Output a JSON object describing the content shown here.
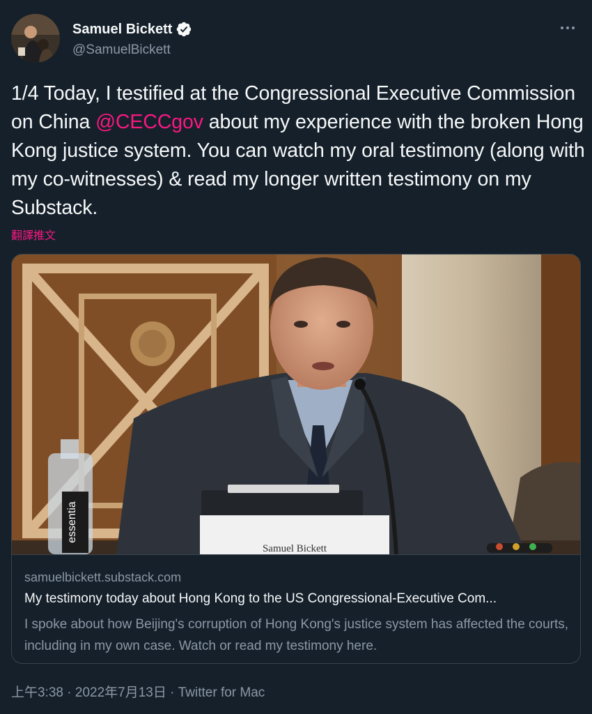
{
  "author": {
    "display_name": "Samuel Bickett",
    "handle": "@SamuelBickett",
    "verified_icon": "verified-badge-icon"
  },
  "tweet": {
    "part1": "1/4 Today, I testified at the Congressional Executive Commission on China ",
    "mention": "@CECCgov",
    "part2": " about my experience with the broken Hong Kong justice system. You can watch my oral testimony (along with my co-witnesses) & read my longer written testimony on my Substack.",
    "translate_label": "翻譯推文"
  },
  "card": {
    "domain": "samuelbickett.substack.com",
    "title": "My testimony today about Hong Kong to the US Congressional-Executive Com...",
    "description": "I spoke about how Beijing's corruption of Hong Kong's justice system has affected the courts, including in my own case. Watch or read my testimony here.",
    "image_placard": "Samuel Bickett",
    "image_bottle_label": "essentia"
  },
  "meta": {
    "time": "上午3:38",
    "separator1": " · ",
    "date": "2022年7月13日",
    "separator2": " · ",
    "source": "Twitter for Mac"
  },
  "colors": {
    "background": "#15202b",
    "text": "#f7f9f9",
    "secondary": "#8b98a5",
    "accent": "#f91880",
    "border": "#38444d"
  }
}
